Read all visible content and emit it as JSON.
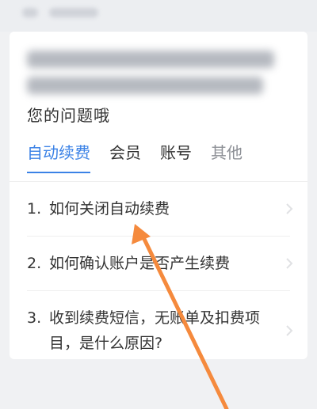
{
  "intro": {
    "visible_line": "您的问题哦"
  },
  "tabs": [
    {
      "label": "自动续费"
    },
    {
      "label": "会员"
    },
    {
      "label": "账号"
    },
    {
      "label": "其他"
    }
  ],
  "questions": [
    {
      "number": "1.",
      "text": "如何关闭自动续费"
    },
    {
      "number": "2.",
      "text": "如何确认账户是否产生续费"
    },
    {
      "number": "3.",
      "text": "收到续费短信，无账单及扣费项目，是什么原因?"
    }
  ],
  "colors": {
    "accent": "#3b82e6",
    "arrow": "#f58a3d"
  }
}
